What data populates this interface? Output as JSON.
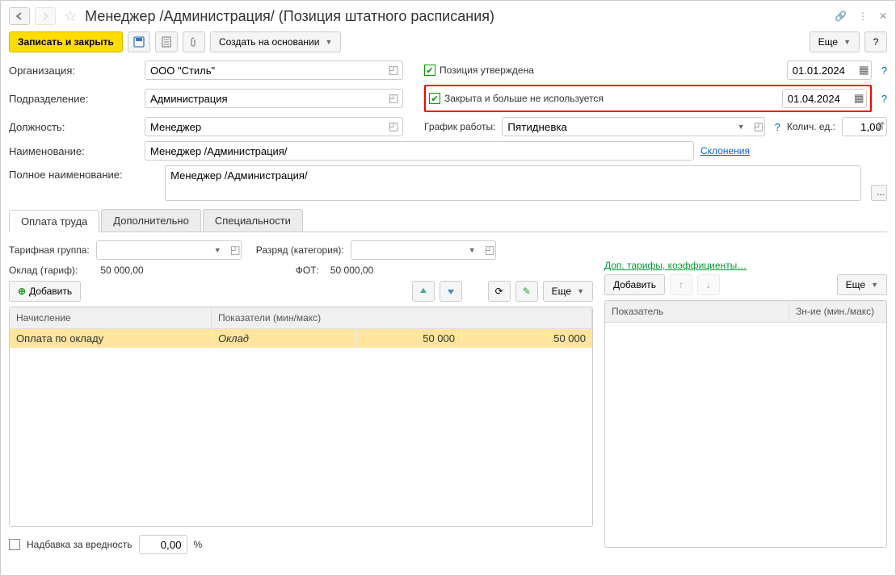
{
  "header": {
    "title": "Менеджер /Администрация/ (Позиция штатного расписания)"
  },
  "toolbar": {
    "save_close": "Записать и закрыть",
    "create_based": "Создать на основании",
    "more": "Еще"
  },
  "fields": {
    "org_label": "Организация:",
    "org_value": "ООО \"Стиль\"",
    "dept_label": "Подразделение:",
    "dept_value": "Администрация",
    "job_label": "Должность:",
    "job_value": "Менеджер",
    "name_label": "Наименование:",
    "name_value": "Менеджер /Администрация/",
    "fullname_label": "Полное наименование:",
    "fullname_value": "Менеджер /Администрация/",
    "approved_label": "Позиция утверждена",
    "approved_date": "01.01.2024",
    "closed_label": "Закрыта и больше не используется",
    "closed_date": "01.04.2024",
    "schedule_label": "График работы:",
    "schedule_value": "Пятидневка",
    "qty_label": "Колич. ед.:",
    "qty_value": "1,00",
    "declensions_link": "Склонения"
  },
  "tabs": {
    "pay": "Оплата труда",
    "extra": "Дополнительно",
    "spec": "Специальности"
  },
  "pay": {
    "tariff_group_label": "Тарифная группа:",
    "rank_label": "Разряд (категория):",
    "salary_label": "Оклад (тариф):",
    "salary_value": "50 000,00",
    "fot_label": "ФОТ:",
    "fot_value": "50 000,00",
    "add_btn": "Добавить",
    "more_btn": "Еще",
    "coeff_link": "Доп. тарифы, коэффициенты…",
    "table": {
      "col1": "Начисление",
      "col2": "Показатели (мин/макс)",
      "row1_name": "Оплата по окладу",
      "row1_indicator": "Оклад",
      "row1_min": "50 000",
      "row1_max": "50 000"
    },
    "right_table": {
      "col1": "Показатель",
      "col2": "Зн-ие (мин./макс)"
    },
    "hazard_label": "Надбавка за вредность",
    "hazard_value": "0,00",
    "hazard_unit": "%"
  }
}
